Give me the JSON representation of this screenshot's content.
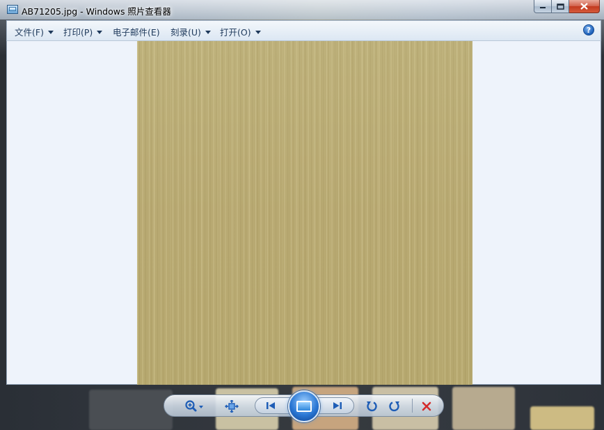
{
  "window": {
    "title": "AB71205.jpg - Windows 照片查看器"
  },
  "menu": {
    "items": [
      {
        "label": "文件(F)",
        "has_dropdown": true
      },
      {
        "label": "打印(P)",
        "has_dropdown": true
      },
      {
        "label": "电子邮件(E)",
        "has_dropdown": false
      },
      {
        "label": "刻录(U)",
        "has_dropdown": true
      },
      {
        "label": "打开(O)",
        "has_dropdown": true
      }
    ],
    "help_glyph": "?"
  },
  "controls": {
    "zoom_icon": "zoom-icon",
    "fit_icon": "actual-size-icon",
    "previous_icon": "previous-icon",
    "slideshow_icon": "slideshow-icon",
    "next_icon": "next-icon",
    "rotate_ccw_icon": "rotate-counterclockwise-icon",
    "rotate_cw_icon": "rotate-clockwise-icon",
    "delete_icon": "delete-icon"
  },
  "colors": {
    "accent": "#1e5db6",
    "delete": "#d42a2a",
    "photo": "#b8a972"
  }
}
